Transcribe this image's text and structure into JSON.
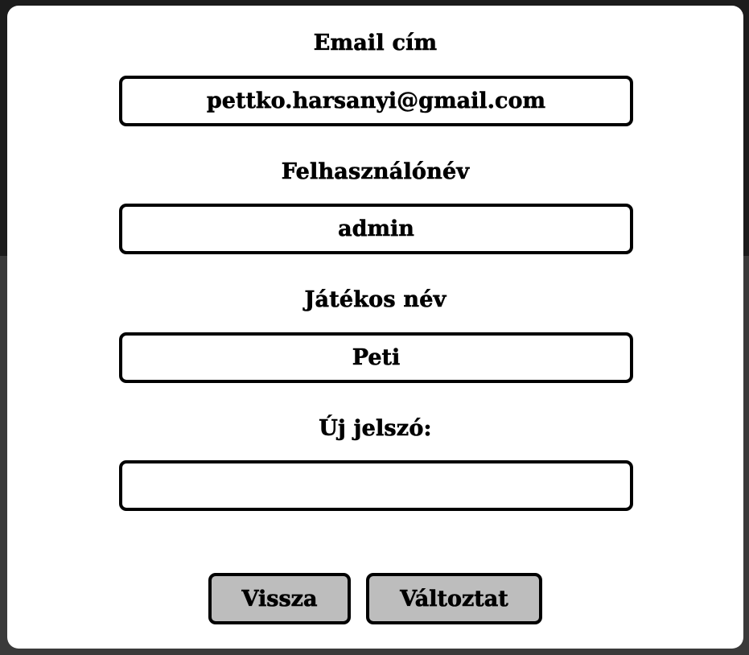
{
  "form": {
    "email": {
      "label": "Email cím",
      "value": "pettko.harsanyi@gmail.com"
    },
    "username": {
      "label": "Felhasználónév",
      "value": "admin"
    },
    "player_name": {
      "label": "Játékos név",
      "value": "Peti"
    },
    "new_password": {
      "label": "Új jelszó:",
      "value": ""
    }
  },
  "buttons": {
    "back_label": "Vissza",
    "change_label": "Változtat"
  },
  "colors": {
    "modal_background": "#ffffff",
    "button_background": "#bdbdbd",
    "border": "#000000",
    "backdrop": "#1c1c1c"
  }
}
